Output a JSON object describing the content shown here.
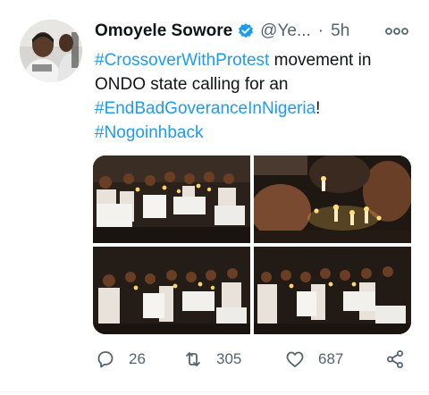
{
  "tweet": {
    "author_name": "Omoyele Sowore",
    "handle": "@Ye...",
    "separator": "·",
    "time": "5h",
    "verified": true,
    "text": {
      "hashtag1": "#CrossoverWithProtest",
      "plain1": " movement in ONDO state calling for an ",
      "hashtag2": "#EndBadGoveranceInNigeria",
      "plain2": "! ",
      "hashtag3": "#Nogoinhback"
    },
    "media_count": 4,
    "actions": {
      "reply_count": "26",
      "retweet_count": "305",
      "like_count": "687"
    }
  },
  "icons": {
    "verified": "verified-badge-icon",
    "more": "more-icon",
    "reply": "reply-icon",
    "retweet": "retweet-icon",
    "like": "like-icon",
    "share": "share-icon"
  },
  "colors": {
    "accent": "#1d9bf0",
    "text_primary": "#0f1419",
    "text_secondary": "#536471"
  }
}
